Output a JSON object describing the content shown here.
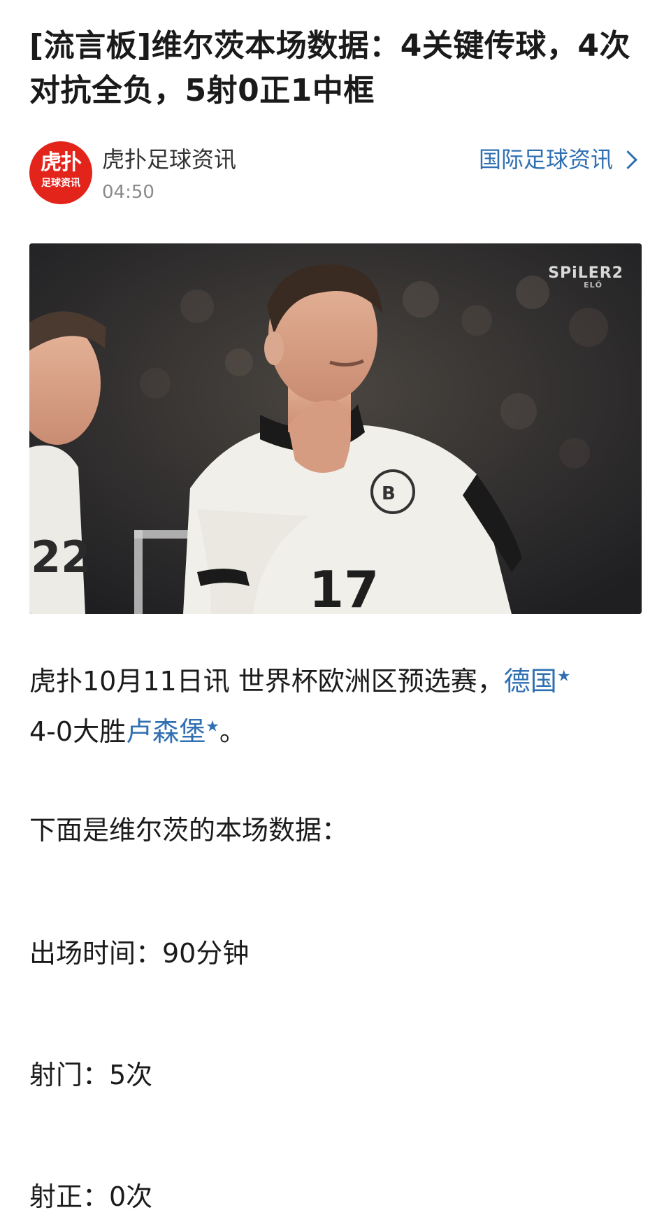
{
  "article": {
    "title": "[流言板]维尔茨本场数据：4关键传球，4次对抗全负，5射0正1中框"
  },
  "source": {
    "logo_text": "虎扑",
    "logo_subtext": "足球资讯",
    "name": "虎扑足球资讯",
    "time": "04:50",
    "category_link": "国际足球资讯",
    "logo_color": "#e3241b"
  },
  "photo": {
    "watermark": "SPiLER2",
    "watermark_sub": "ELŐ",
    "jersey_number": "17",
    "left_player_number": "22"
  },
  "body": {
    "lead_prefix": "虎扑10月11日讯 世界杯欧洲区预选赛，",
    "team1": "德国",
    "score_text": "4-0大胜",
    "team2": "卢森堡",
    "lead_suffix": "。",
    "intro": "下面是维尔茨的本场数据：",
    "stats": [
      "出场时间：90分钟",
      "射门：5次",
      "射正：0次"
    ]
  },
  "colors": {
    "link": "#2f6fb2",
    "text": "#1b1b1b",
    "meta": "#8a8a8a"
  }
}
